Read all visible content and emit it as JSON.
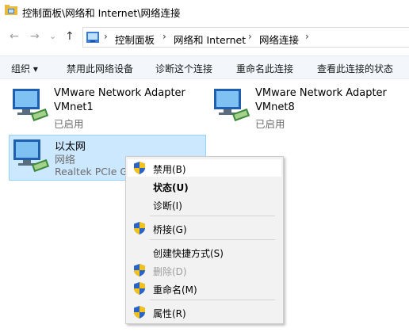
{
  "window": {
    "title": "控制面板\\网络和 Internet\\网络连接"
  },
  "nav": {
    "back_icon": "←",
    "forward_icon": "→",
    "recent_icon": "⌄",
    "up_icon": "↑",
    "breadcrumb": [
      "控制面板",
      "网络和 Internet",
      "网络连接"
    ],
    "separator": "›"
  },
  "toolbar": {
    "organize": "组织 ▾",
    "disable_device": "禁用此网络设备",
    "diagnose": "诊断这个连接",
    "rename": "重命名此连接",
    "view_status": "查看此连接的状态"
  },
  "adapters": [
    {
      "name": "VMware Network Adapter",
      "sub": "VMnet1",
      "status": "已启用"
    },
    {
      "name": "VMware Network Adapter",
      "sub": "VMnet8",
      "status": "已启用"
    },
    {
      "name": "以太网",
      "sub": "网络",
      "status": "Realtek PCIe GbE Family Controller"
    }
  ],
  "context_menu": {
    "disable": "禁用(B)",
    "status": "状态(U)",
    "diagnose": "诊断(I)",
    "bridge": "桥接(G)",
    "shortcut": "创建快捷方式(S)",
    "delete": "删除(D)",
    "rename": "重命名(M)",
    "properties": "属性(R)"
  },
  "colors": {
    "selection_bg": "#cce8ff",
    "selection_border": "#99d1ff",
    "shield_blue": "#2a63c8",
    "shield_yellow": "#f2c21b"
  }
}
